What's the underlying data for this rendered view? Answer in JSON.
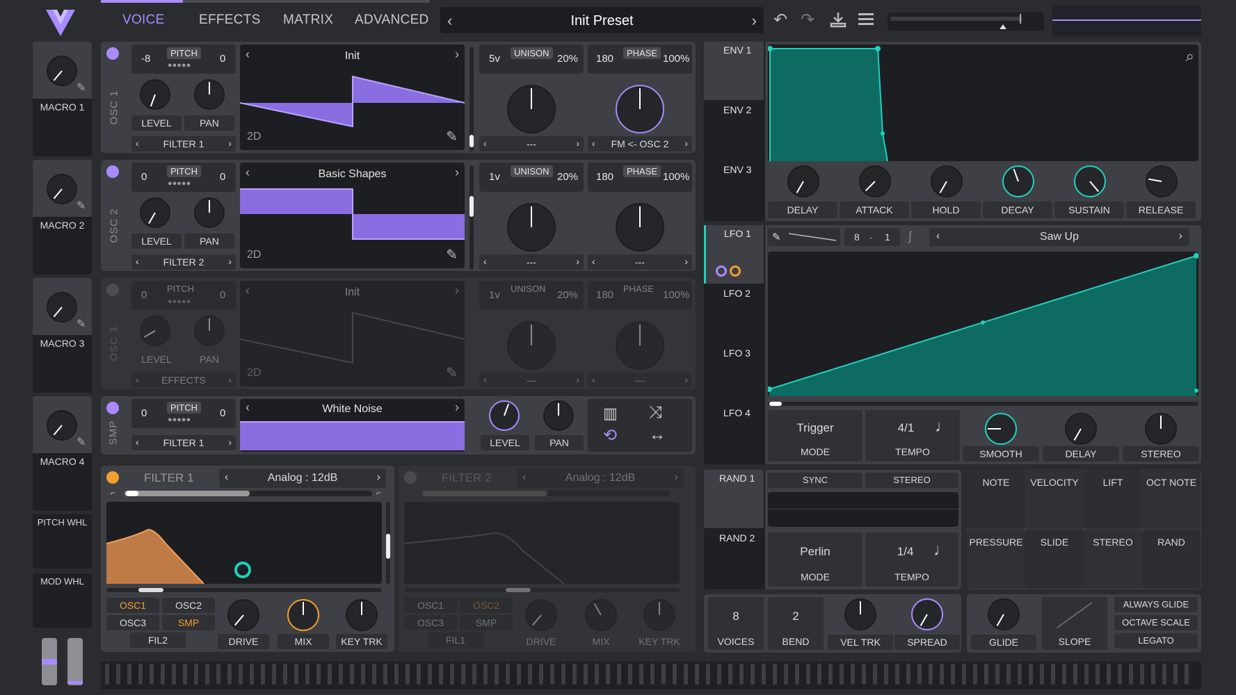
{
  "header": {
    "tabs": [
      "VOICE",
      "EFFECTS",
      "MATRIX",
      "ADVANCED"
    ],
    "preset": "Init Preset",
    "icons": [
      "undo-icon",
      "redo-icon",
      "save-icon",
      "menu-icon"
    ]
  },
  "macros": [
    "MACRO 1",
    "MACRO 2",
    "MACRO 3",
    "MACRO 4"
  ],
  "wheels": {
    "pitch": "PITCH WHL",
    "mod": "MOD WHL"
  },
  "osc1": {
    "label": "OSC 1",
    "pitch_left": "-8",
    "pitch_label": "PITCH",
    "pitch_right": "0",
    "wave": "Init",
    "mode": "2D",
    "level": "LEVEL",
    "pan": "PAN",
    "dest": "FILTER 1",
    "unison_voices": "5v",
    "unison_label": "UNISON",
    "unison_pct": "20%",
    "phase_val": "180",
    "phase_label": "PHASE",
    "phase_pct": "100%",
    "unison_sel": "---",
    "phase_sel": "FM <- OSC 2"
  },
  "osc2": {
    "label": "OSC 2",
    "pitch_left": "0",
    "pitch_label": "PITCH",
    "pitch_right": "0",
    "wave": "Basic Shapes",
    "mode": "2D",
    "level": "LEVEL",
    "pan": "PAN",
    "dest": "FILTER 2",
    "unison_voices": "1v",
    "unison_label": "UNISON",
    "unison_pct": "20%",
    "phase_val": "180",
    "phase_label": "PHASE",
    "phase_pct": "100%",
    "unison_sel": "---",
    "phase_sel": "---"
  },
  "osc3": {
    "label": "OSC 3",
    "pitch_left": "0",
    "pitch_label": "PITCH",
    "pitch_right": "0",
    "wave": "Init",
    "mode": "2D",
    "level": "LEVEL",
    "pan": "PAN",
    "dest": "EFFECTS",
    "unison_voices": "1v",
    "unison_label": "UNISON",
    "unison_pct": "20%",
    "phase_val": "180",
    "phase_label": "PHASE",
    "phase_pct": "100%",
    "unison_sel": "---",
    "phase_sel": "---"
  },
  "smp": {
    "label": "SMP",
    "pitch_left": "0",
    "pitch_label": "PITCH",
    "pitch_right": "0",
    "sample": "White Noise",
    "dest": "FILTER 1",
    "level": "LEVEL",
    "pan": "PAN"
  },
  "filter1": {
    "label": "FILTER 1",
    "type": "Analog : 12dB",
    "src": [
      "OSC1",
      "OSC2",
      "OSC3",
      "SMP"
    ],
    "fil": "FIL2",
    "knobs": [
      "DRIVE",
      "MIX",
      "KEY TRK"
    ]
  },
  "filter2": {
    "label": "FILTER 2",
    "type": "Analog : 12dB",
    "src": [
      "OSC1",
      "OSC2",
      "OSC3",
      "SMP"
    ],
    "fil": "FIL1",
    "knobs": [
      "DRIVE",
      "MIX",
      "KEY TRK"
    ]
  },
  "env": {
    "tabs": [
      "ENV 1",
      "ENV 2",
      "ENV 3"
    ],
    "knobs": [
      "DELAY",
      "ATTACK",
      "HOLD",
      "DECAY",
      "SUSTAIN",
      "RELEASE"
    ]
  },
  "lfo": {
    "tabs": [
      "LFO 1",
      "LFO 2",
      "LFO 3",
      "LFO 4"
    ],
    "grid_a": "8",
    "grid_b": "1",
    "shape": "Saw Up",
    "mode_val": "Trigger",
    "mode_label": "MODE",
    "tempo_val": "4/1",
    "tempo_label": "TEMPO",
    "knobs": [
      "SMOOTH",
      "DELAY",
      "STEREO"
    ]
  },
  "rand": {
    "tabs": [
      "RAND 1",
      "RAND 2"
    ],
    "sync": "SYNC",
    "stereo": "STEREO",
    "mode_val": "Perlin",
    "mode_label": "MODE",
    "tempo_val": "1/4",
    "tempo_label": "TEMPO"
  },
  "mod_sources": [
    "NOTE",
    "VELOCITY",
    "LIFT",
    "OCT NOTE",
    "PRESSURE",
    "SLIDE",
    "STEREO",
    "RAND"
  ],
  "voice": {
    "voices_val": "8",
    "voices_label": "VOICES",
    "bend_val": "2",
    "bend_label": "BEND",
    "veltrk": "VEL TRK",
    "spread": "SPREAD",
    "glide": "GLIDE",
    "slope": "SLOPE",
    "opts": [
      "ALWAYS GLIDE",
      "OCTAVE SCALE",
      "LEGATO"
    ]
  },
  "colors": {
    "accent": "#a98bff",
    "teal": "#1fd1bd",
    "orange": "#f0a030",
    "bg": "#2a2c30",
    "panel": "#3e4045"
  }
}
